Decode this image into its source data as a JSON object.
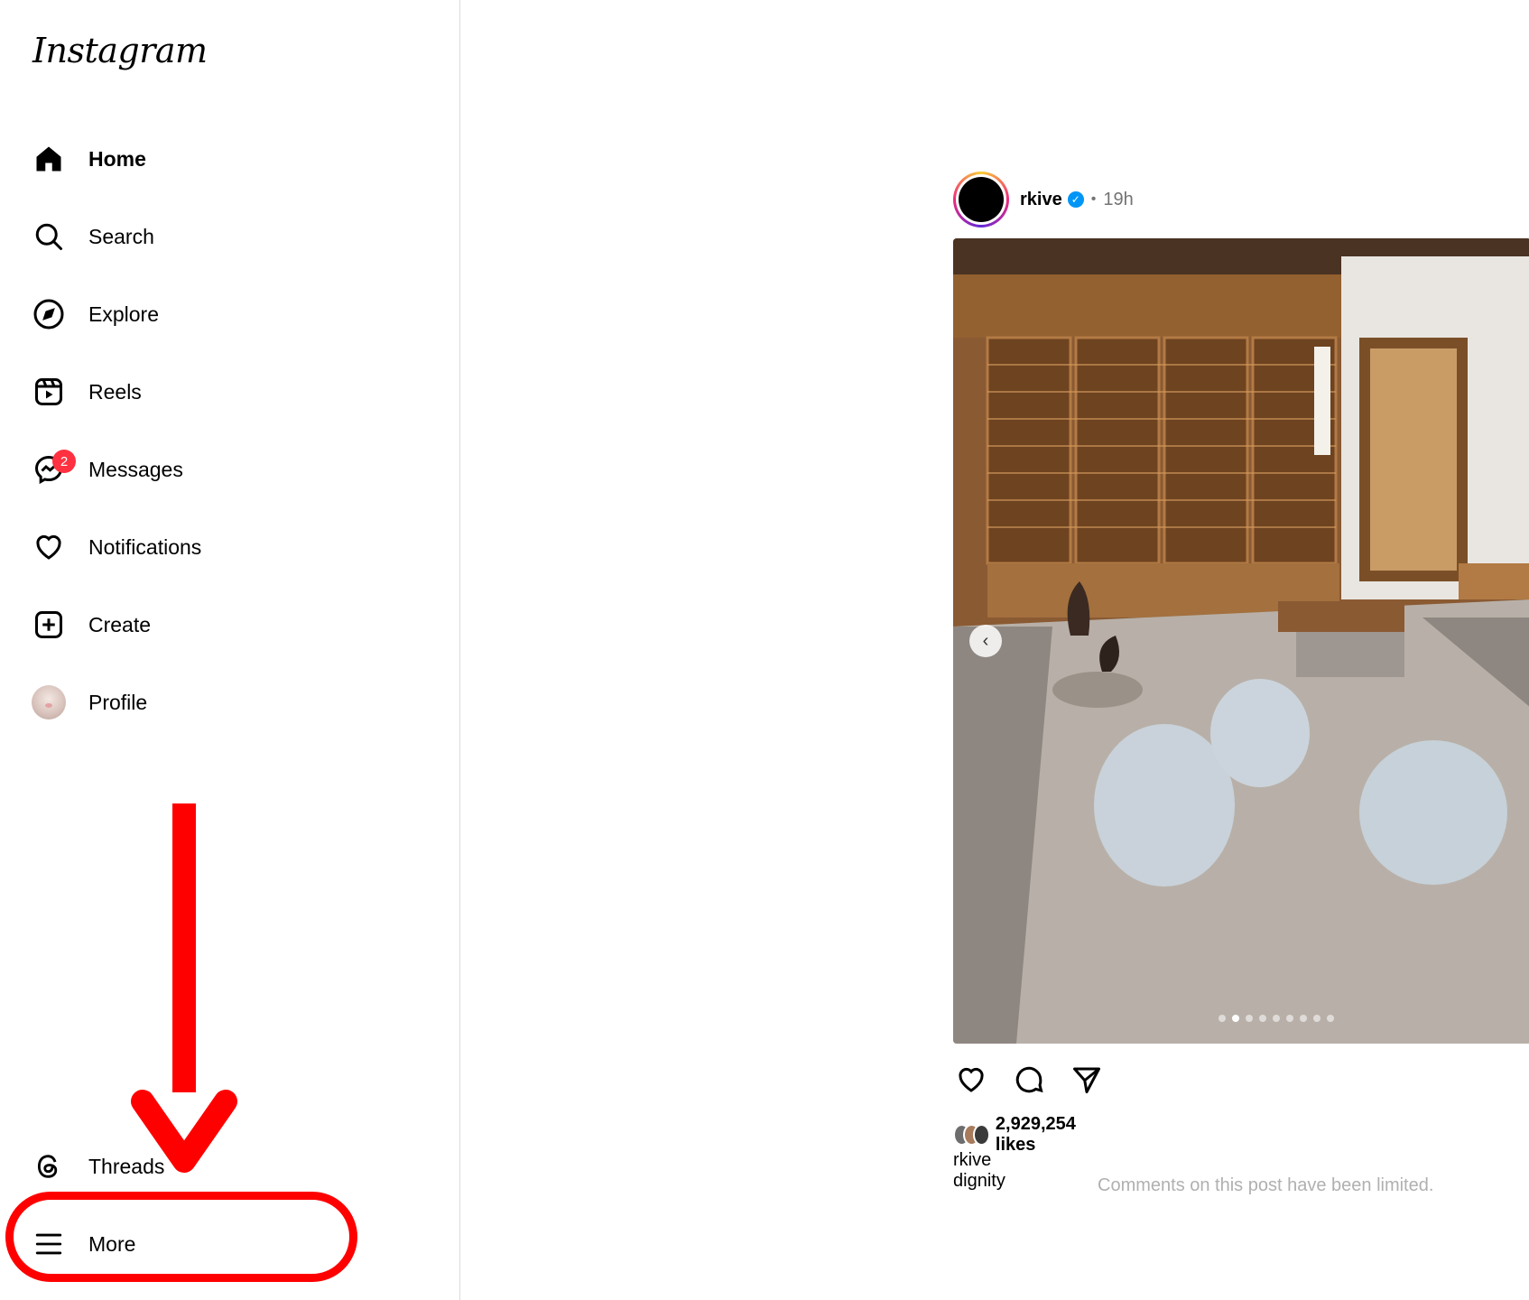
{
  "app": {
    "logo": "Instagram"
  },
  "sidebar": {
    "items": [
      {
        "label": "Home",
        "icon": "home-icon",
        "active": true
      },
      {
        "label": "Search",
        "icon": "search-icon"
      },
      {
        "label": "Explore",
        "icon": "compass-icon"
      },
      {
        "label": "Reels",
        "icon": "reels-icon"
      },
      {
        "label": "Messages",
        "icon": "messenger-icon",
        "badge": "2"
      },
      {
        "label": "Notifications",
        "icon": "heart-icon"
      },
      {
        "label": "Create",
        "icon": "plus-square-icon"
      },
      {
        "label": "Profile",
        "icon": "avatar"
      }
    ],
    "bottom": [
      {
        "label": "Threads",
        "icon": "threads-icon"
      },
      {
        "label": "More",
        "icon": "hamburger-icon"
      }
    ]
  },
  "annotation": {
    "color": "#ff0000"
  },
  "post": {
    "username": "rkive",
    "verified": true,
    "separator": "•",
    "time": "19h",
    "carousel_total": 9,
    "carousel_active": 2,
    "likes": "2,929,254 likes",
    "caption_user": "rkive",
    "caption_text": "dignity",
    "comments_notice": "Comments on this post have been limited."
  }
}
